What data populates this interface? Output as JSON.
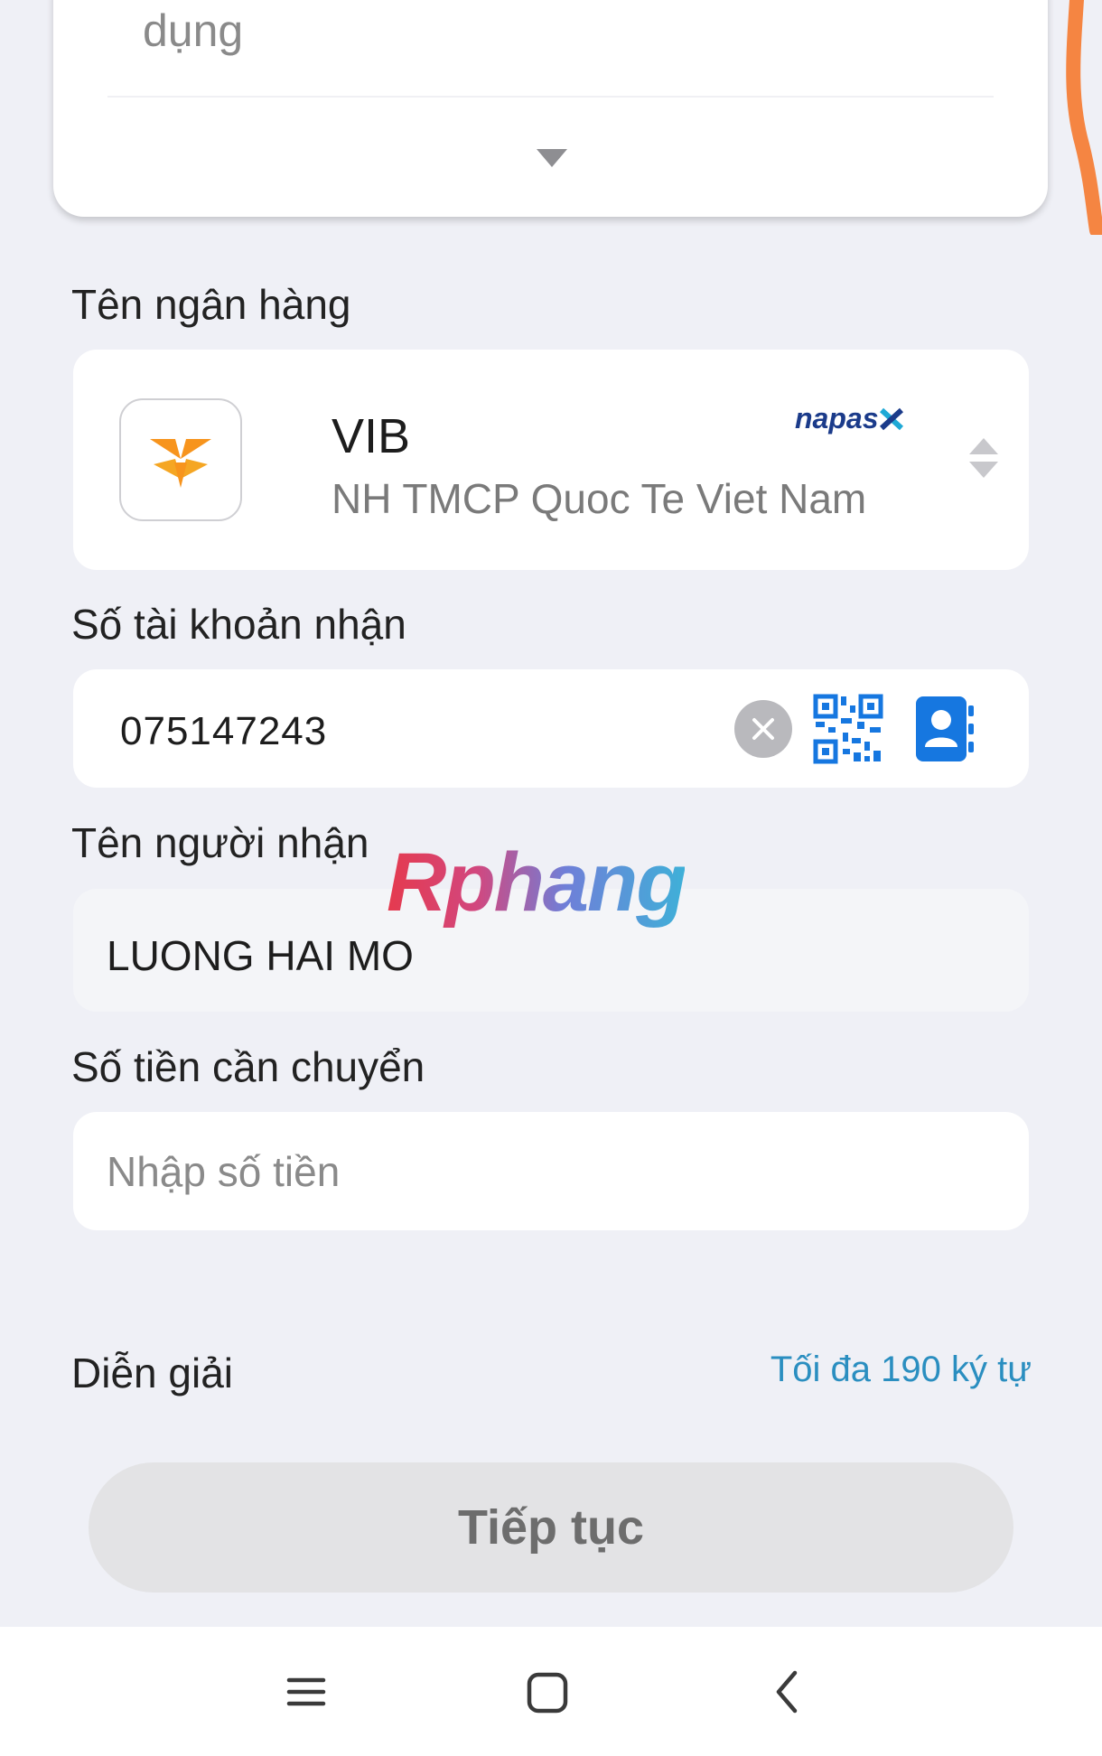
{
  "top_card": {
    "method_text": "dụng",
    "dropdown_icon": "caret-down-icon"
  },
  "bank": {
    "label": "Tên ngân hàng",
    "code": "VIB",
    "name": "NH TMCP Quoc Te Viet Nam",
    "network": "napas",
    "logo_icon": "vib-logo-icon",
    "select_icon": "sort-arrows-icon"
  },
  "account": {
    "label": "Số tài khoản nhận",
    "value": "075147243",
    "clear_icon": "clear-icon",
    "qr_icon": "qr-code-icon",
    "contacts_icon": "contacts-icon"
  },
  "recipient": {
    "label": "Tên người nhận",
    "value": "LUONG HAI MO"
  },
  "watermark": "Rphang",
  "amount": {
    "label": "Số tiền cần chuyển",
    "placeholder": "Nhập số tiền"
  },
  "note": {
    "label": "Diễn giải",
    "limit": "Tối đa 190 ký tự"
  },
  "continue_label": "Tiếp tục",
  "nav": {
    "menu_icon": "menu-icon",
    "home_icon": "home-icon",
    "back_icon": "back-icon"
  },
  "colors": {
    "background": "#eff0f6",
    "accent_blue": "#2a8ec0",
    "contacts_blue": "#1677e0",
    "vib_orange": "#f7941d",
    "button_disabled": "#e3e3e5"
  }
}
